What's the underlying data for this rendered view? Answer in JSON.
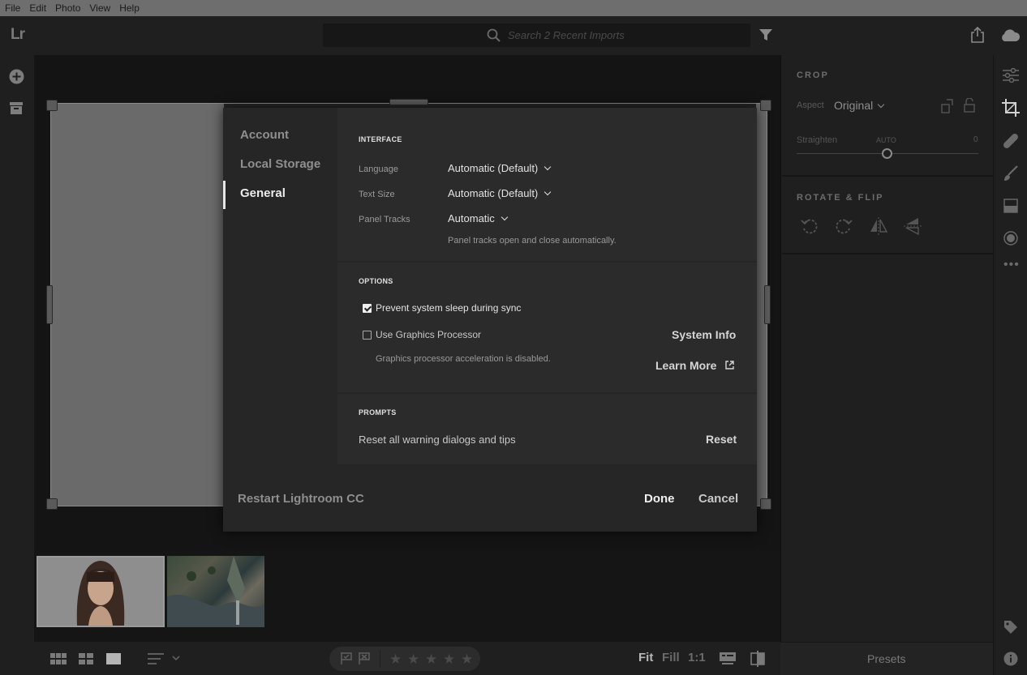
{
  "menu": [
    "File",
    "Edit",
    "Photo",
    "View",
    "Help"
  ],
  "app": {
    "logo": "Lr"
  },
  "search": {
    "placeholder": "Search 2 Recent Imports"
  },
  "bottom": {
    "fit": "Fit",
    "fill": "Fill",
    "one_to_one": "1:1",
    "rating": {
      "value": 0,
      "max": 5
    }
  },
  "right_panel": {
    "crop_title": "CROP",
    "aspect_label": "Aspect",
    "aspect_value": "Original",
    "straighten_label": "Straighten",
    "straighten_auto": "AUTO",
    "straighten_value": "0",
    "rotate_title": "ROTATE & FLIP",
    "presets": "Presets"
  },
  "dialog": {
    "nav": [
      "Account",
      "Local Storage",
      "General"
    ],
    "active_nav": "General",
    "interface": {
      "title": "INTERFACE",
      "language_label": "Language",
      "language_value": "Automatic (Default)",
      "text_size_label": "Text Size",
      "text_size_value": "Automatic (Default)",
      "panel_tracks_label": "Panel Tracks",
      "panel_tracks_value": "Automatic",
      "panel_tracks_note": "Panel tracks open and close automatically."
    },
    "options": {
      "title": "OPTIONS",
      "prevent_sleep_label": "Prevent system sleep during sync",
      "prevent_sleep_checked": true,
      "gpu_label": "Use Graphics Processor",
      "gpu_checked": false,
      "gpu_note": "Graphics processor acceleration is disabled.",
      "system_info": "System Info",
      "learn_more": "Learn More"
    },
    "prompts": {
      "title": "PROMPTS",
      "reset_label": "Reset all warning dialogs and tips",
      "reset_button": "Reset"
    },
    "footer": {
      "restart": "Restart Lightroom CC",
      "done": "Done",
      "cancel": "Cancel"
    }
  }
}
